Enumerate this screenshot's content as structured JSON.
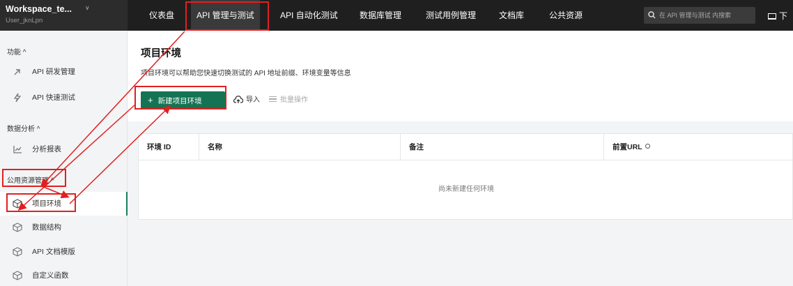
{
  "workspace": {
    "name": "Workspace_te...",
    "user": "User_jknLpn"
  },
  "nav": [
    {
      "label": "仪表盘"
    },
    {
      "label": "API 管理与测试"
    },
    {
      "label": "API 自动化测试"
    },
    {
      "label": "数据库管理"
    },
    {
      "label": "测试用例管理"
    },
    {
      "label": "文档库"
    },
    {
      "label": "公共资源"
    }
  ],
  "search": {
    "placeholder": "在 API 管理与测试 内搜索"
  },
  "topright": {
    "label": "下"
  },
  "sidebar": {
    "groups": [
      {
        "label": "功能 ^"
      },
      {
        "label": "数据分析 ^"
      },
      {
        "label": "公用资源管理 ^"
      }
    ],
    "items": [
      {
        "label": "API 研发管理"
      },
      {
        "label": "API 快速测试"
      },
      {
        "label": "分析报表"
      },
      {
        "label": "项目环境"
      },
      {
        "label": "数据结构"
      },
      {
        "label": "API 文档模版"
      },
      {
        "label": "自定义函数"
      }
    ]
  },
  "main": {
    "title": "项目环境",
    "description": "项目环境可以帮助您快速切换测试的 API 地址前缀、环境变量等信息",
    "new_button": "新建项目环境",
    "import_label": "导入",
    "batch_label": "批量操作",
    "columns": [
      "环境 ID",
      "名称",
      "备注",
      "前置URL"
    ],
    "empty_text": "尚未新建任何环境"
  },
  "colors": {
    "accent": "#137352",
    "annotation": "#e02020",
    "topbar": "#1f1f20"
  }
}
